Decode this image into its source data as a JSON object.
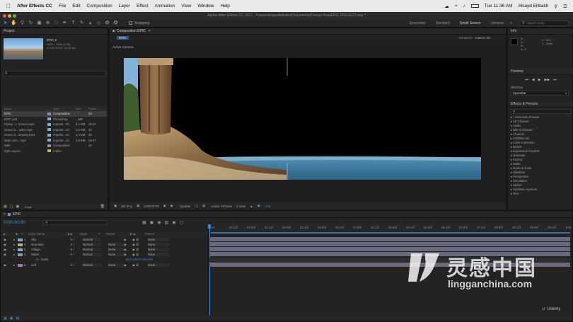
{
  "menubar": {
    "app": "After Effects CC",
    "items": [
      "File",
      "Edit",
      "Composition",
      "Layer",
      "Effect",
      "Animation",
      "View",
      "Window",
      "Help"
    ],
    "clock": "Tue 11:36 AM",
    "user": "Alsayd Eltbakh"
  },
  "titlebar": {
    "title": "Adobe After Effects CC 2017 - /Users/alsayedeltbakh/Documents/Course Now/EPIC PROJECT.aep *"
  },
  "toolbar": {
    "snapping": "Snapping",
    "workspaces": [
      "Essentials",
      "Standard",
      "Small Screen",
      "Libraries"
    ],
    "search": "Search Help"
  },
  "project": {
    "tab": "Project",
    "comp_name": "EPIC ▾",
    "comp_info": [
      "1843 x 1630 (1.00)",
      "Δ 0:00:10:00, 24.00 fps"
    ],
    "headers": [
      "Name",
      "Type",
      "Size",
      "Frame"
    ],
    "items": [
      {
        "name": "EPIC",
        "color": "#8a8ab4",
        "type": "Composition",
        "size": "",
        "frame": "24",
        "selected": true
      },
      {
        "name": "EPIC.psd",
        "color": "#7ab0d8",
        "type": "Photoshop",
        "size": "...MB",
        "frame": "",
        "selected": false
      },
      {
        "name": "Flying ...c Screen.mp4",
        "color": "#7ab0d8",
        "type": "Importe...OI",
        "size": "9.2 MB",
        "frame": "29.97",
        "selected": false
      },
      {
        "name": "Green S... Lake.mp4",
        "color": "#7ab0d8",
        "type": "Importe...OI",
        "size": "3.5 MB",
        "frame": "30",
        "selected": false
      },
      {
        "name": "Green S...umping.mp4",
        "color": "#7ab0d8",
        "type": "Importe...OI",
        "size": "4.4 MB",
        "frame": "30",
        "selected": false
      },
      {
        "name": "Mate com...mp4",
        "color": "#7ab0d8",
        "type": "Importe...OI",
        "size": "2.8 MB",
        "frame": "29.97",
        "selected": false
      },
      {
        "name": "Split",
        "color": "#8a8ab4",
        "type": "Composition",
        "size": "",
        "frame": "24",
        "selected": false
      },
      {
        "name": "Split Layers",
        "color": "#c9b23a",
        "type": "Folder",
        "size": "",
        "frame": "",
        "selected": false
      }
    ],
    "bpc": "8 bpc"
  },
  "composition": {
    "tab": "Composition EPIC",
    "breadcrumb": "EPIC",
    "renderer_label": "Renderer:",
    "renderer": "Classic 3D",
    "view_label": "Active Camera",
    "footer": {
      "zoom": "(51.2%)",
      "time": "0:00:00:00",
      "resolution": "Quarter",
      "camera": "Active Camera",
      "views": "1 View",
      "offset": "+0.0"
    }
  },
  "info": {
    "title": "Info",
    "lines": [
      "R :",
      "G :",
      "B :",
      "A : 0"
    ],
    "coords": [
      "X : 519",
      "Y : 1084"
    ]
  },
  "preview": {
    "title": "Preview"
  },
  "shortcut": {
    "title": "Shortcut",
    "value": "Spacebar"
  },
  "effects": {
    "title": "Effects & Presets",
    "items": [
      "* Animation Presets",
      "3D Channel",
      "Audio",
      "Blur & Sharpen",
      "Channel",
      "CINEMA 4D",
      "Color Correction",
      "Distort",
      "Expression Controls",
      "Generate",
      "Keying",
      "Matte",
      "Noise & Grain",
      "Obsolete",
      "Perspective",
      "Simulation",
      "Stylize",
      "Synthetic Aperture",
      "Text"
    ]
  },
  "timeline": {
    "tab": "EPIC",
    "timecode": "0:00:00:00",
    "headers": [
      "#",
      "Layer Name",
      "Mode",
      "T",
      "TrkMat",
      "Parent"
    ],
    "layers": [
      {
        "num": "1",
        "name": "Sky",
        "mode": "Normal",
        "trkmat": "",
        "parent": "None"
      },
      {
        "num": "2",
        "name": "Mountain",
        "mode": "Normal",
        "trkmat": "None",
        "parent": "None"
      },
      {
        "num": "3",
        "name": "Village",
        "mode": "Normal",
        "trkmat": "None",
        "parent": "None"
      },
      {
        "num": "4",
        "name": "Water",
        "mode": "Normal",
        "trkmat": "None",
        "parent": "None"
      }
    ],
    "scale_label": "Scale",
    "scale_value": "254.0,254.0,254.0%",
    "layer5": {
      "num": "5",
      "name": "Left",
      "mode": "Normal",
      "trkmat": "None",
      "parent": "None"
    },
    "ruler": [
      "0s",
      "00:12f",
      "01:00f",
      "01:12f",
      "02:00f",
      "02:12f",
      "03:00f",
      "03:12f",
      "04:00f",
      "04:12f",
      "05:00f",
      "05:12f",
      "06:00f",
      "06:12f",
      "07:00f",
      "07:12f",
      "08:00f",
      "08:12f",
      "09:00f",
      "09:12f",
      "10:0"
    ]
  },
  "watermark": {
    "cn": "灵感中国",
    "url": "lingganchina.com",
    "udemy": "Udemy"
  }
}
